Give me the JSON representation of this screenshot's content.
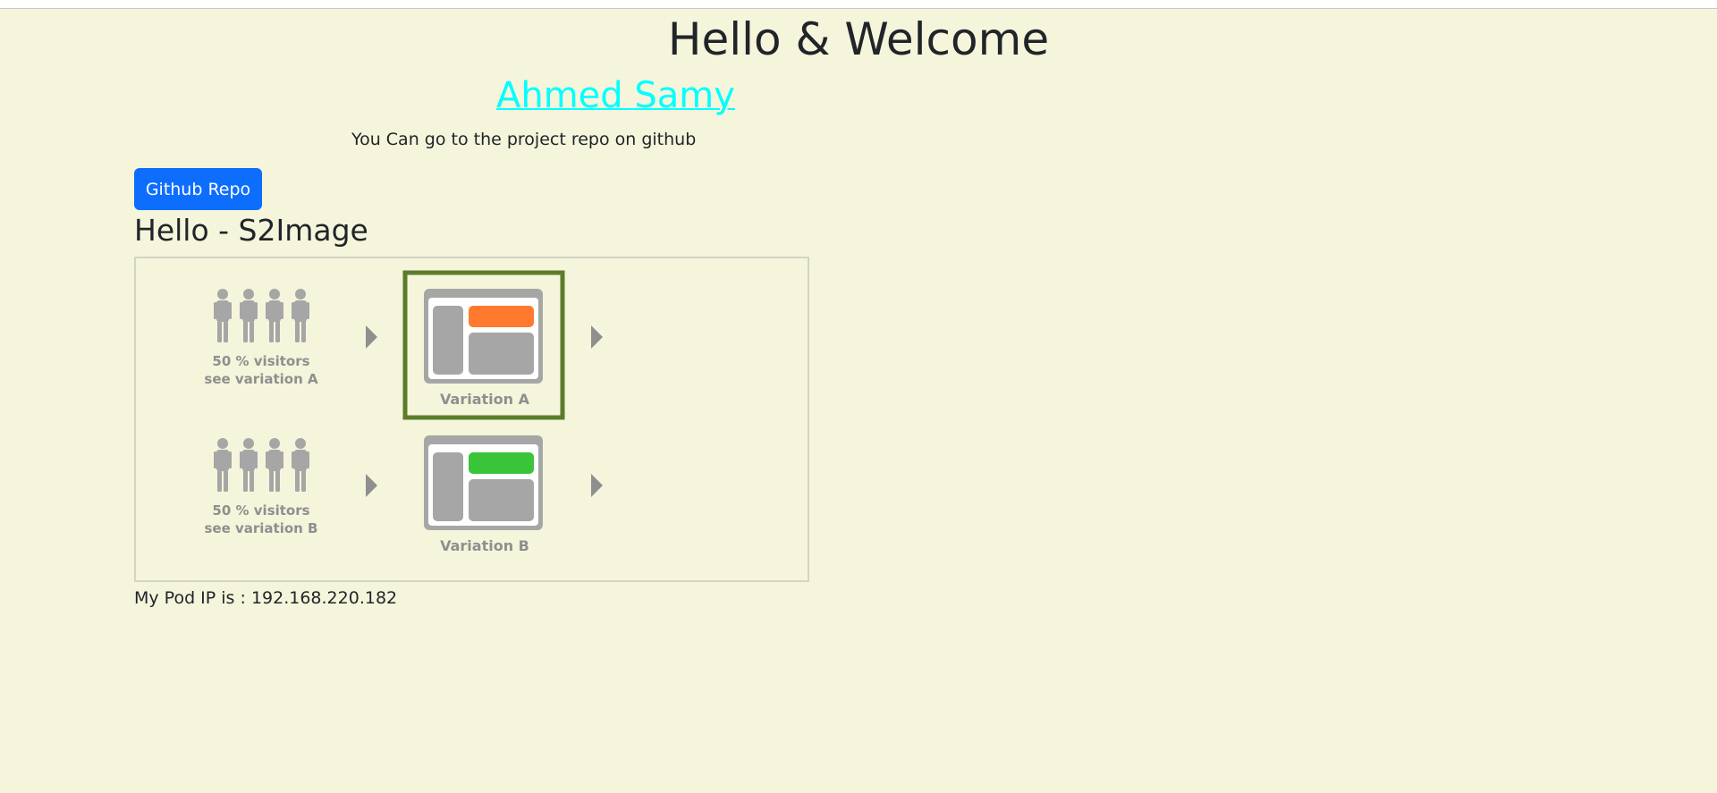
{
  "header": {
    "title": "Hello & Welcome",
    "author_link": "Ahmed Samy",
    "repo_text": "You Can go to the project repo on github"
  },
  "actions": {
    "github_button_label": "Github Repo"
  },
  "section": {
    "title": "Hello - S2Image"
  },
  "ab_image": {
    "row_a": {
      "caption_line1": "50 % visitors",
      "caption_line2": "see variation A",
      "variation_label": "Variation A",
      "accent_color": "#ff7a2f",
      "highlight_border_color": "#5a7d2a"
    },
    "row_b": {
      "caption_line1": "50 % visitors",
      "caption_line2": "see variation B",
      "variation_label": "Variation B",
      "accent_color": "#3ac43a"
    }
  },
  "footer": {
    "pod_ip_text": "My Pod IP is : 192.168.220.182"
  },
  "colors": {
    "page_background": "#f5f5dc",
    "button_primary": "#0d6efd",
    "author_link": "#00ffff",
    "icon_gray": "#a6a6a6"
  }
}
